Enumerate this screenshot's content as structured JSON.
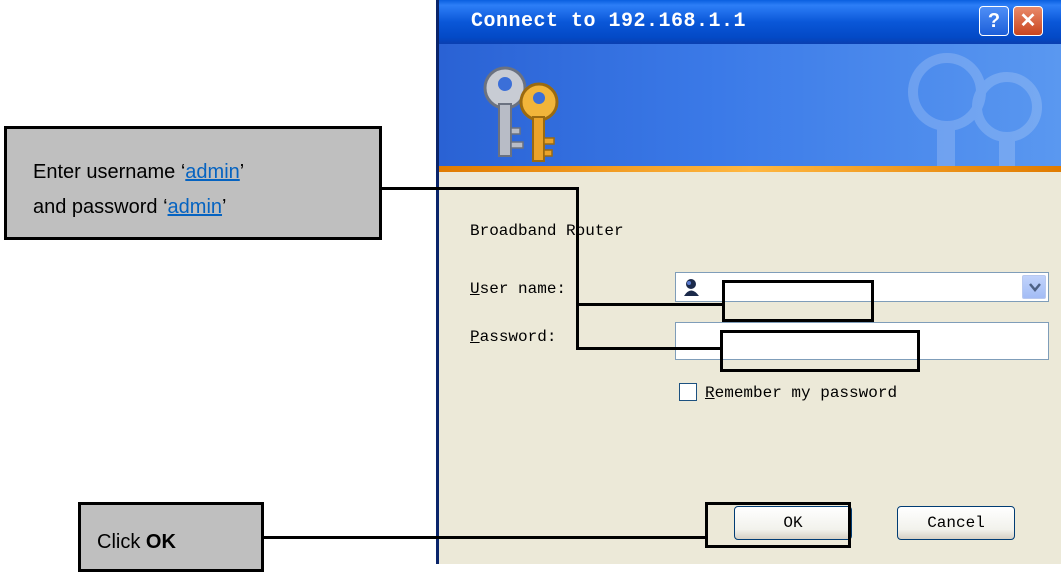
{
  "dialog": {
    "title": "Connect to 192.168.1.1",
    "help_label": "?",
    "close_label": "✕",
    "realm": "Broadband Router",
    "username_label": "User name:",
    "username_access_key": "U",
    "username_rest": "ser name:",
    "username_value": "",
    "password_label": "Password:",
    "password_access_key": "P",
    "password_rest": "assword:",
    "password_value": "",
    "remember_access_key": "R",
    "remember_rest": "emember my password",
    "remember_checked": false,
    "ok_label": "OK",
    "cancel_label": "Cancel",
    "icons": [
      "keys-icon",
      "user-icon",
      "chevron-down-icon"
    ]
  },
  "callouts": {
    "top": {
      "line1_prefix": "Enter  username  ‘",
      "line1_link": "admin",
      "line1_suffix": "’",
      "line2_prefix": "and password ‘",
      "line2_link": "admin",
      "line2_suffix": "’"
    },
    "bottom": {
      "prefix": "Click ",
      "bold": "OK"
    }
  },
  "colors": {
    "titlebar": "#0a57d8",
    "dialog_bg": "#ece9d8",
    "callout_bg": "#bfbfbf",
    "link": "#0563c1"
  }
}
